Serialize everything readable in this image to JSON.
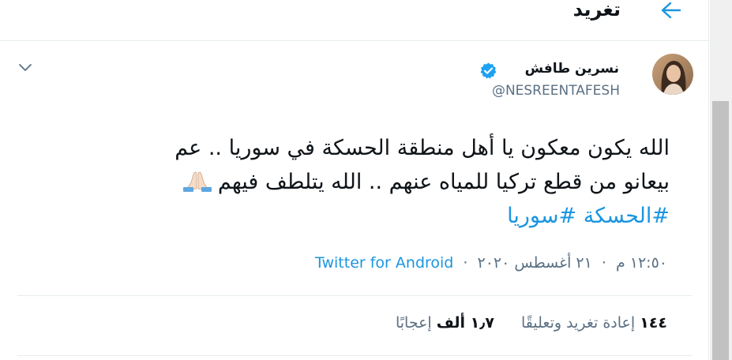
{
  "header": {
    "title": "تغريد"
  },
  "tweet": {
    "author_name": "نسرين طافش",
    "handle": "@NESREENTAFESH",
    "text_line1": "الله يكون معكون يا أهل منطقة الحسكة في سوريا .. عم",
    "text_line2": "بيعانو من قطع تركيا للمياه عنهم .. الله يتلطف فيهم",
    "hashtag1": "#الحسكة",
    "hashtag2": "#سوريا",
    "time": "١٢:٥٠ م",
    "date": "٢١ أغسطس ٢٠٢٠",
    "source": "Twitter for Android",
    "separator": "·"
  },
  "stats": {
    "retweets_count": "١٤٤",
    "retweets_label": "إعادة تغريد وتعليقًا",
    "likes_count": "١٫٧ ألف",
    "likes_label": "إعجابًا"
  },
  "colors": {
    "accent": "#1b95e0",
    "text": "#0f1419",
    "muted": "#5b7083",
    "border": "#e6ecf0"
  },
  "icons": {
    "back": "back-arrow-icon",
    "caret": "chevron-down-icon",
    "verified": "verified-badge-icon",
    "emoji": "folded-hands-emoji"
  }
}
